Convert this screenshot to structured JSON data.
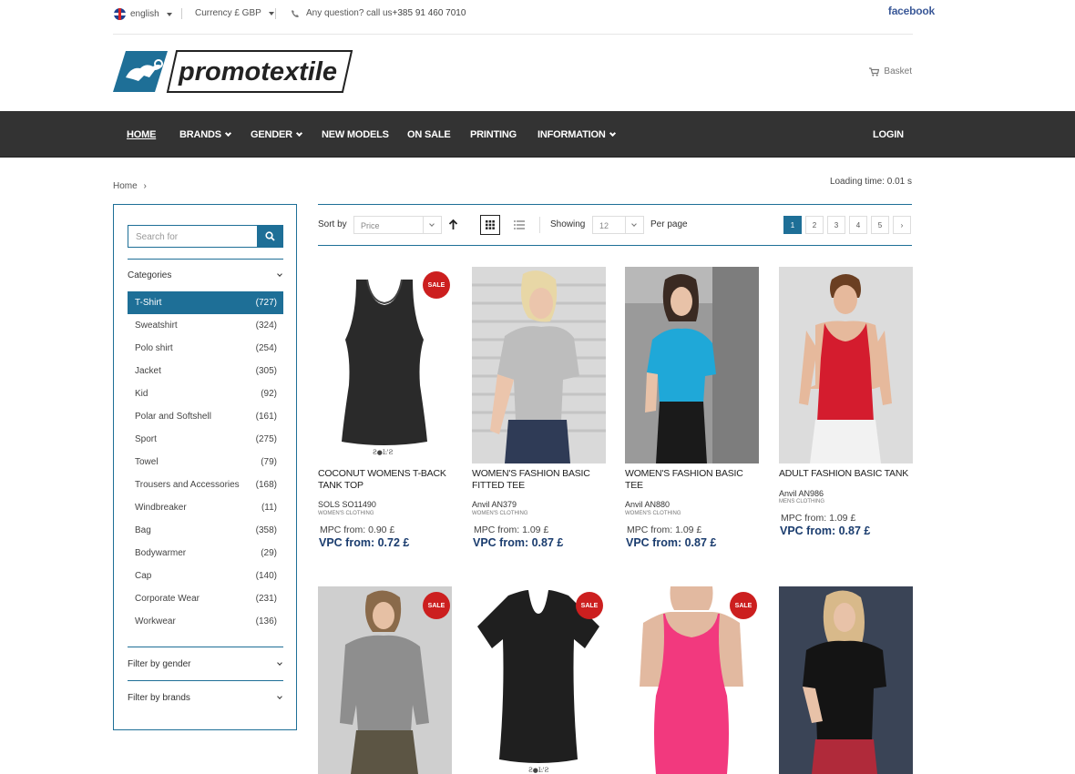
{
  "topbar": {
    "language": "english",
    "currency": "Currency £ GBP",
    "question_prefix": "Any question? call us",
    "phone": "+385 91 460 7010",
    "facebook": "facebook"
  },
  "header": {
    "logo_text": "promotextile",
    "basket": "Basket"
  },
  "nav": {
    "items": [
      "HOME",
      "BRANDS",
      "GENDER",
      "NEW MODELS",
      "ON SALE",
      "PRINTING",
      "INFORMATION"
    ],
    "login": "LOGIN"
  },
  "breadcrumb": {
    "home": "Home",
    "sep": "›"
  },
  "loading_time": "Loading time: 0.01 s",
  "sidebar": {
    "search_placeholder": "Search for",
    "categories_title": "Categories",
    "categories": [
      {
        "label": "T-Shirt",
        "count": "(727)"
      },
      {
        "label": "Sweatshirt",
        "count": "(324)"
      },
      {
        "label": "Polo shirt",
        "count": "(254)"
      },
      {
        "label": "Jacket",
        "count": "(305)"
      },
      {
        "label": "Kid",
        "count": "(92)"
      },
      {
        "label": "Polar and Softshell",
        "count": "(161)"
      },
      {
        "label": "Sport",
        "count": "(275)"
      },
      {
        "label": "Towel",
        "count": "(79)"
      },
      {
        "label": "Trousers and Accessories",
        "count": "(168)"
      },
      {
        "label": "Windbreaker",
        "count": "(11)"
      },
      {
        "label": "Bag",
        "count": "(358)"
      },
      {
        "label": "Bodywarmer",
        "count": "(29)"
      },
      {
        "label": "Cap",
        "count": "(140)"
      },
      {
        "label": "Corporate Wear",
        "count": "(231)"
      },
      {
        "label": "Workwear",
        "count": "(136)"
      }
    ],
    "filter_gender": "Filter by gender",
    "filter_brands": "Filter by brands"
  },
  "toolbar": {
    "sort_by": "Sort by",
    "sort_value": "Price",
    "showing": "Showing",
    "showing_value": "12",
    "per_page": "Per page",
    "pages": [
      "1",
      "2",
      "3",
      "4",
      "5"
    ],
    "next": "›"
  },
  "products": [
    {
      "title": "COCONUT WOMENS T-BACK TANK TOP",
      "sku": "SOLS SO11490",
      "category": "WOMEN'S CLOTHING",
      "mpc": "MPC from: 0.90 £",
      "vpc": "VPC from: 0.72 £",
      "sale": "SALE"
    },
    {
      "title": "WOMEN'S FASHION BASIC FITTED TEE",
      "sku": "Anvil AN379",
      "category": "WOMEN'S CLOTHING",
      "mpc": "MPC from: 1.09 £",
      "vpc": "VPC from: 0.87 £"
    },
    {
      "title": "WOMEN'S FASHION BASIC TEE",
      "sku": "Anvil AN880",
      "category": "WOMEN'S CLOTHING",
      "mpc": "MPC from: 1.09 £",
      "vpc": "VPC from: 0.87 £"
    },
    {
      "title": "ADULT FASHION BASIC TANK",
      "sku": "Anvil AN986",
      "category": "MENS CLOTHING",
      "mpc": "MPC from: 1.09 £",
      "vpc": "VPC from: 0.87 £"
    }
  ],
  "row2_sale": [
    "SALE",
    "SALE",
    "SALE"
  ],
  "colors": {
    "accent": "#1e6f97",
    "nav": "#333333",
    "sale": "#cc1f1f",
    "price": "#1a3c6e"
  }
}
